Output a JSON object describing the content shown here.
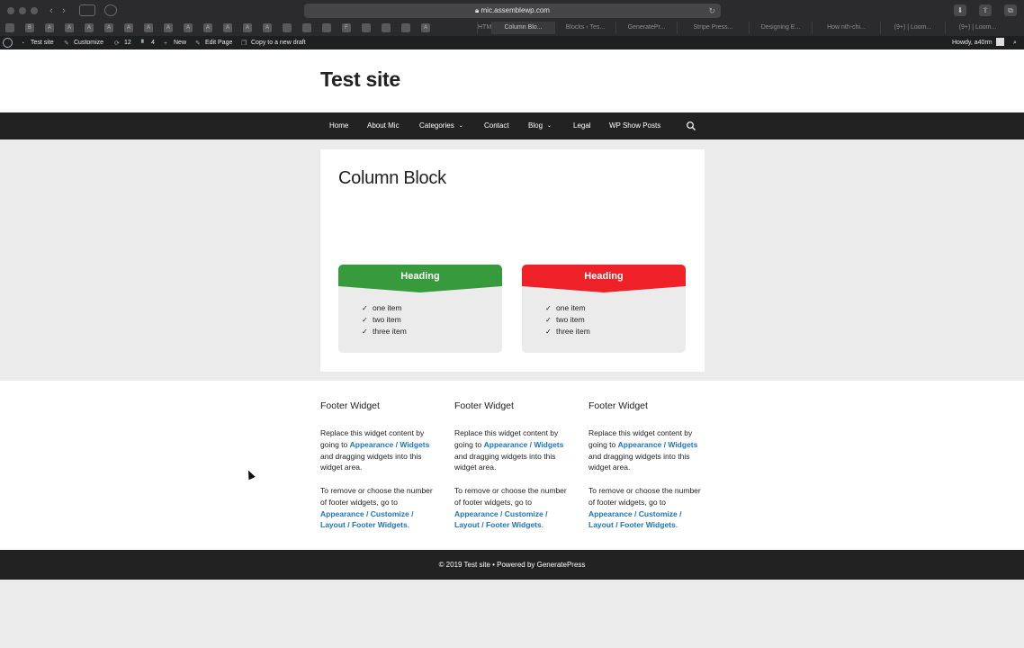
{
  "browser": {
    "url": "mic.assemblewp.com",
    "lock_icon": "lock-icon",
    "favorites": [
      "B",
      "A",
      "A",
      "A",
      "A",
      "A",
      "A",
      "A",
      "A",
      "A",
      "A",
      "A",
      "A",
      "F",
      "A"
    ],
    "tabs": [
      "HTML",
      "Column Blo...",
      "Blocks ‹ Tes...",
      "GeneratePr...",
      "Stripe Press...",
      "Designing E...",
      "How nth-chi...",
      "(9+) | Loom...",
      "(9+) | Loom..."
    ]
  },
  "adminbar": {
    "site_name": "Test site",
    "customize": "Customize",
    "updates_count": "12",
    "comments_count": "4",
    "new": "New",
    "edit_page": "Edit Page",
    "copy_draft": "Copy to a new draft",
    "howdy": "Howdy, a40rm"
  },
  "site": {
    "title": "Test site",
    "nav": [
      {
        "label": "Home"
      },
      {
        "label": "About Mic"
      },
      {
        "label": "Categories",
        "has_dropdown": true
      },
      {
        "label": "Contact"
      },
      {
        "label": "Blog",
        "has_dropdown": true
      },
      {
        "label": "Legal"
      },
      {
        "label": "WP Show Posts"
      }
    ]
  },
  "page": {
    "title": "Column Block",
    "columns": [
      {
        "heading": "Heading",
        "color": "#379b3d",
        "items": [
          "one item",
          "two item",
          "three item"
        ]
      },
      {
        "heading": "Heading",
        "color": "#ee2128",
        "items": [
          "one item",
          "two item",
          "three item"
        ]
      }
    ]
  },
  "footer_widgets": [
    {
      "title": "Footer Widget",
      "p1_a": "Replace this widget content by going to ",
      "p1_link": "Appearance / Widgets",
      "p1_b": " and dragging widgets into this widget area.",
      "p2_a": "To remove or choose the number of footer widgets, go to ",
      "p2_link": "Appearance / Customize / Layout / Footer Widgets",
      "p2_b": "."
    },
    {
      "title": "Footer Widget",
      "p1_a": "Replace this widget content by going to ",
      "p1_link": "Appearance / Widgets",
      "p1_b": " and dragging widgets into this widget area.",
      "p2_a": "To remove or choose the number of footer widgets, go to ",
      "p2_link": "Appearance / Customize / Layout / Footer Widgets",
      "p2_b": "."
    },
    {
      "title": "Footer Widget",
      "p1_a": "Replace this widget content by going to ",
      "p1_link": "Appearance / Widgets",
      "p1_b": " and dragging widgets into this widget area.",
      "p2_a": "To remove or choose the number of footer widgets, go to ",
      "p2_link": "Appearance / Customize / Layout / Footer Widgets",
      "p2_b": "."
    }
  ],
  "footer": {
    "copyright": "© 2019 Test site • Powered by GeneratePress"
  },
  "colors": {
    "nav_bg": "#222222",
    "link": "#1e73be",
    "page_bg": "#ebebeb"
  }
}
